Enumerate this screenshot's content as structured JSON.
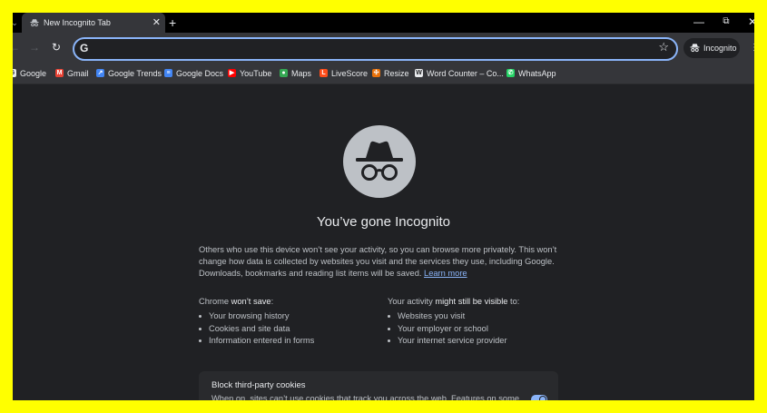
{
  "tab": {
    "title": "New Incognito Tab",
    "close_glyph": "✕",
    "new_tab_glyph": "+"
  },
  "window_controls": {
    "minimize": "—",
    "restore": "⧉",
    "close": "✕"
  },
  "toolbar": {
    "back_glyph": "←",
    "forward_glyph": "→",
    "reload_glyph": "↻",
    "omnibox_value": "",
    "omnibox_icon": "G",
    "star_glyph": "☆",
    "incognito_label": "Incognito",
    "menu_glyph": "⋮"
  },
  "bookmarks": [
    {
      "label": "Google",
      "icon": "google-icon",
      "color": "#e8eaed"
    },
    {
      "label": "Gmail",
      "icon": "gmail-icon",
      "color": "#ea4335"
    },
    {
      "label": "Google Trends",
      "icon": "google-trends-icon",
      "color": "#4285f4"
    },
    {
      "label": "Google Docs",
      "icon": "google-docs-icon",
      "color": "#4285f4"
    },
    {
      "label": "YouTube",
      "icon": "youtube-icon",
      "color": "#ff0000"
    },
    {
      "label": "Maps",
      "icon": "maps-icon",
      "color": "#34a853"
    },
    {
      "label": "LiveScore",
      "icon": "livescore-icon",
      "color": "#ff4d1a"
    },
    {
      "label": "Resize",
      "icon": "resize-icon",
      "color": "#e8710a"
    },
    {
      "label": "Word Counter – Co...",
      "icon": "word-counter-icon",
      "color": "#e8eaed"
    },
    {
      "label": "WhatsApp",
      "icon": "whatsapp-icon",
      "color": "#25d366"
    }
  ],
  "content": {
    "heading": "You’ve gone Incognito",
    "intro": "Others who use this device won’t see your activity, so you can browse more privately. This won’t change how data is collected by websites you visit and the services they use, including Google. Downloads, bookmarks and reading list items will be saved.",
    "learn_more": "Learn more",
    "wont_save": {
      "title_prefix": "Chrome ",
      "title_bold": "won’t save",
      "title_suffix": ":",
      "items": [
        "Your browsing history",
        "Cookies and site data",
        "Information entered in forms"
      ]
    },
    "might_be_visible": {
      "title_prefix": "Your activity ",
      "title_bold": "might still be visible",
      "title_suffix": " to:",
      "items": [
        "Websites you visit",
        "Your employer or school",
        "Your internet service provider"
      ]
    },
    "cookies_card": {
      "title": "Block third-party cookies",
      "description": "When on, sites can’t use cookies that track you across the web. Features on some sites may break.",
      "toggle_on": true
    }
  },
  "colors": {
    "accent": "#8ab4f8",
    "background": "#202124",
    "frame": "#ffff00"
  }
}
